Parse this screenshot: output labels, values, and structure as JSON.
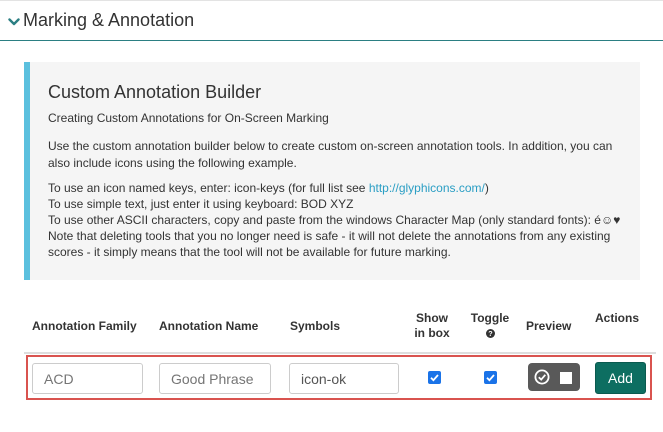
{
  "section": {
    "title": "Marking & Annotation"
  },
  "info": {
    "title": "Custom Annotation Builder",
    "subtitle": "Creating Custom Annotations for On-Screen Marking",
    "paragraph": "Use the custom annotation builder below to create custom on-screen annotation tools. In addition, you can also include icons using the following example.",
    "line1_prefix": "To use an icon named keys, enter: icon-keys (for full list see ",
    "line1_link": "http://glyphicons.com/",
    "line1_suffix": ")",
    "line2": "To use simple text, just enter it using keyboard: BOD XYZ",
    "line3": "To use other ASCII characters, copy and paste from the windows Character Map (only standard fonts): é☺♥",
    "line4": "Note that deleting tools that you no longer need is safe - it will not delete the annotations from any existing scores - it simply means that the tool will not be available for future marking."
  },
  "table": {
    "headers": {
      "family": "Annotation Family",
      "name": "Annotation Name",
      "symbols": "Symbols",
      "show_line1": "Show",
      "show_line2": "in box",
      "toggle": "Toggle",
      "preview": "Preview",
      "actions": "Actions"
    },
    "row": {
      "family_placeholder": "ACD",
      "name_placeholder": "Good Phrase",
      "symbols_value": "icon-ok",
      "show_in_box": true,
      "toggle": true,
      "add_label": "Add"
    }
  },
  "colors": {
    "accent": "#5bc0de",
    "header_rule": "#2b7f83",
    "checkbox": "#1a73e8",
    "add_button": "#0d6e61",
    "highlight_border": "#d9534f",
    "preview_bg": "#595959"
  },
  "icons": {
    "collapse": "chevron-down-icon",
    "help": "question-circle-icon",
    "preview_ok": "ok-circle-icon",
    "preview_square": "square-icon"
  }
}
